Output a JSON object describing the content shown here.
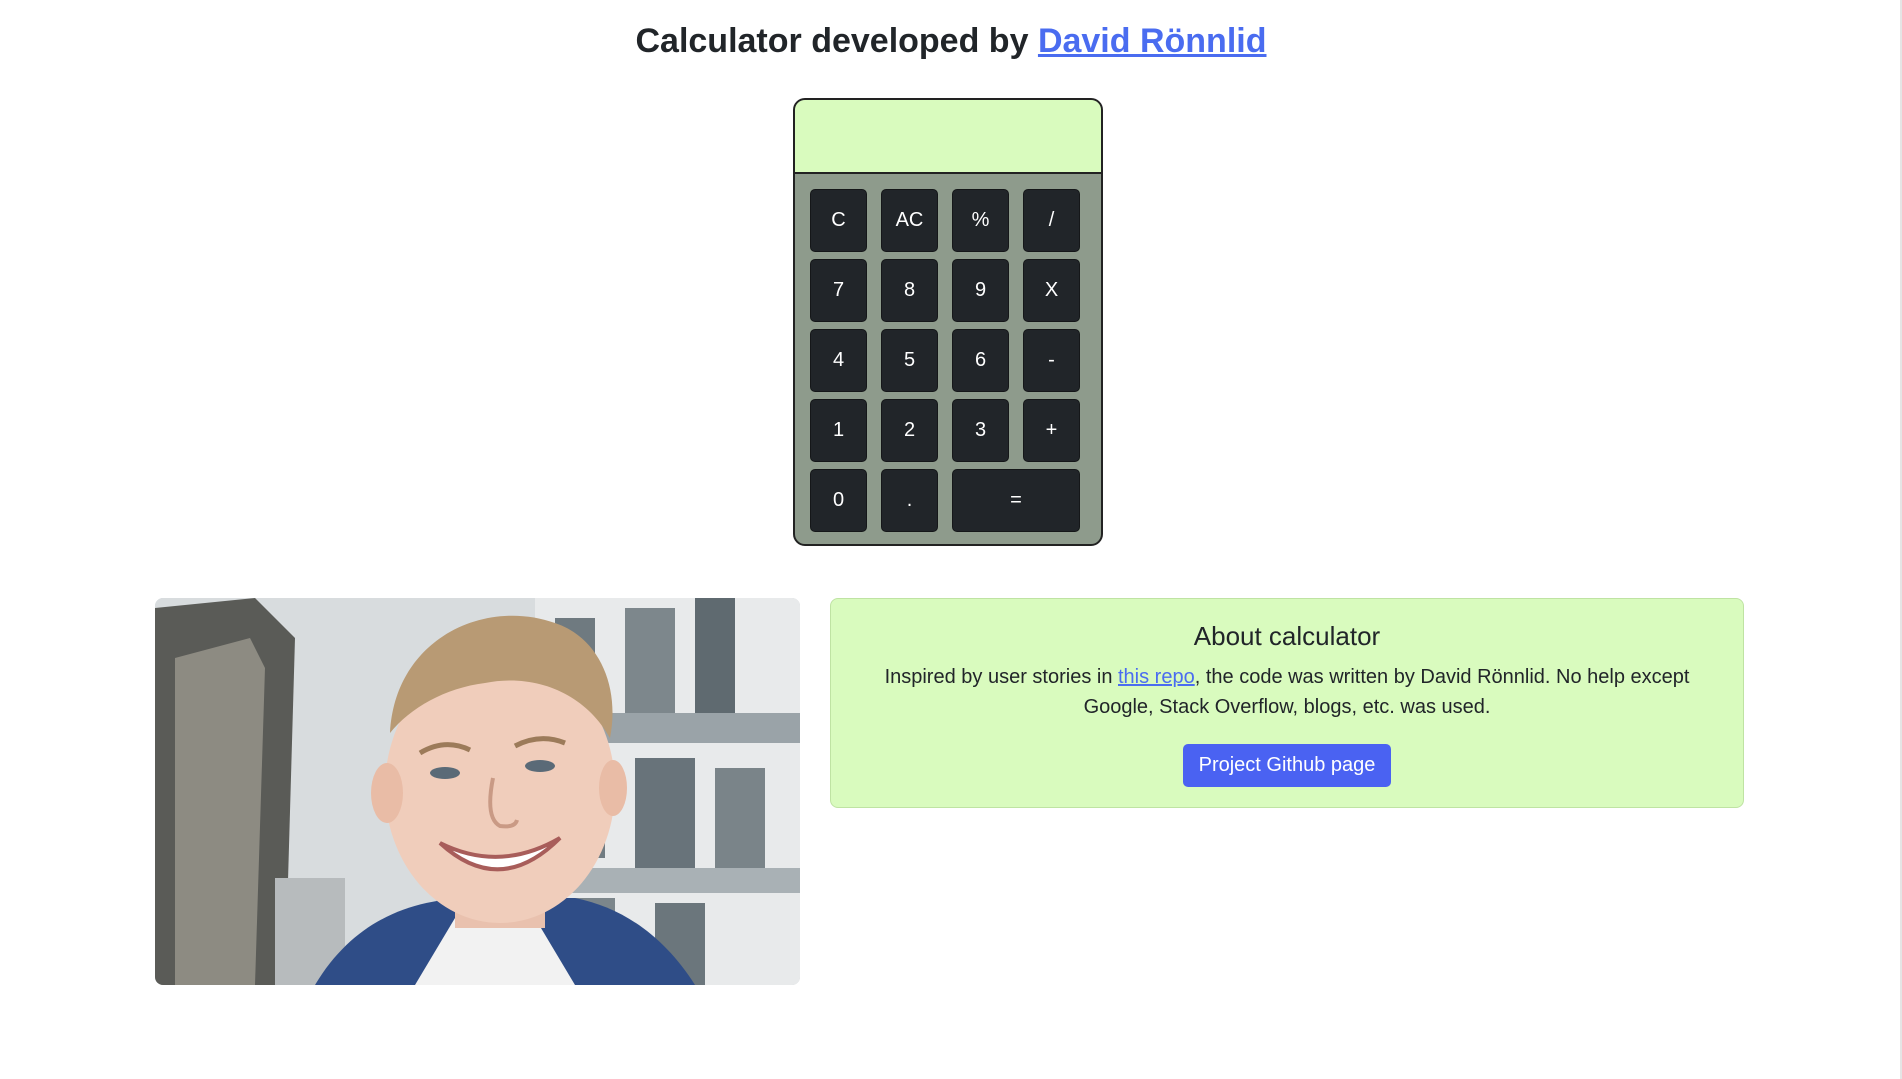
{
  "header": {
    "title_prefix": "Calculator developed by ",
    "author_link": "David Rönnlid"
  },
  "calculator": {
    "display_value": "",
    "keys": [
      {
        "label": "C",
        "name": "key-clear"
      },
      {
        "label": "AC",
        "name": "key-all-clear"
      },
      {
        "label": "%",
        "name": "key-percent"
      },
      {
        "label": "/",
        "name": "key-divide"
      },
      {
        "label": "7",
        "name": "key-7"
      },
      {
        "label": "8",
        "name": "key-8"
      },
      {
        "label": "9",
        "name": "key-9"
      },
      {
        "label": "X",
        "name": "key-multiply"
      },
      {
        "label": "4",
        "name": "key-4"
      },
      {
        "label": "5",
        "name": "key-5"
      },
      {
        "label": "6",
        "name": "key-6"
      },
      {
        "label": "-",
        "name": "key-subtract"
      },
      {
        "label": "1",
        "name": "key-1"
      },
      {
        "label": "2",
        "name": "key-2"
      },
      {
        "label": "3",
        "name": "key-3"
      },
      {
        "label": "+",
        "name": "key-add"
      },
      {
        "label": "0",
        "name": "key-0"
      },
      {
        "label": ".",
        "name": "key-decimal"
      },
      {
        "label": "=",
        "name": "key-equals"
      }
    ]
  },
  "about": {
    "title": "About calculator",
    "text_before_link": "Inspired by user stories in ",
    "link_text": "this repo",
    "text_after_link": ", the code was written by David Rönnlid. No help except Google, Stack Overflow, blogs, etc. was used.",
    "button_label": "Project Github page"
  },
  "colors": {
    "display_bg": "#d9fbbe",
    "calc_body": "#8e9b8c",
    "key_bg": "#212529",
    "link": "#4a6cf0",
    "button": "#4a62f2"
  }
}
